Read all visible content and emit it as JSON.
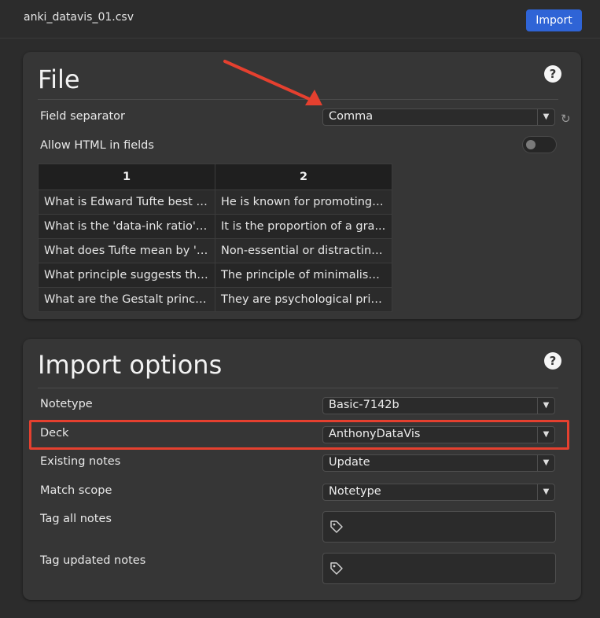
{
  "topbar": {
    "filename": "anki_datavis_01.csv",
    "import_label": "Import"
  },
  "file_section": {
    "title": "File",
    "help_icon": "help-icon",
    "field_separator": {
      "label": "Field separator",
      "value": "Comma"
    },
    "allow_html": {
      "label": "Allow HTML in fields",
      "enabled": false
    },
    "preview": {
      "columns": [
        "1",
        "2"
      ],
      "rows": [
        [
          "What is Edward Tufte best k...",
          "He is known for promoting ..."
        ],
        [
          "What is the 'data-ink ratio' a...",
          "It is the proportion of a gra..."
        ],
        [
          "What does Tufte mean by 'c...",
          "Non-essential or distracting..."
        ],
        [
          "What principle suggests tha...",
          "The principle of minimalism..."
        ],
        [
          "What are the Gestalt princip...",
          "They are psychological prin..."
        ]
      ]
    }
  },
  "import_options": {
    "title": "Import options",
    "notetype": {
      "label": "Notetype",
      "value": "Basic-7142b"
    },
    "deck": {
      "label": "Deck",
      "value": "AnthonyDataVis"
    },
    "existing_notes": {
      "label": "Existing notes",
      "value": "Update"
    },
    "match_scope": {
      "label": "Match scope",
      "value": "Notetype"
    },
    "tag_all": {
      "label": "Tag all notes"
    },
    "tag_updated": {
      "label": "Tag updated notes"
    }
  },
  "colors": {
    "accent": "#2f64d6",
    "highlight": "#e5402f",
    "background": "#2c2c2c",
    "card": "#363636"
  }
}
